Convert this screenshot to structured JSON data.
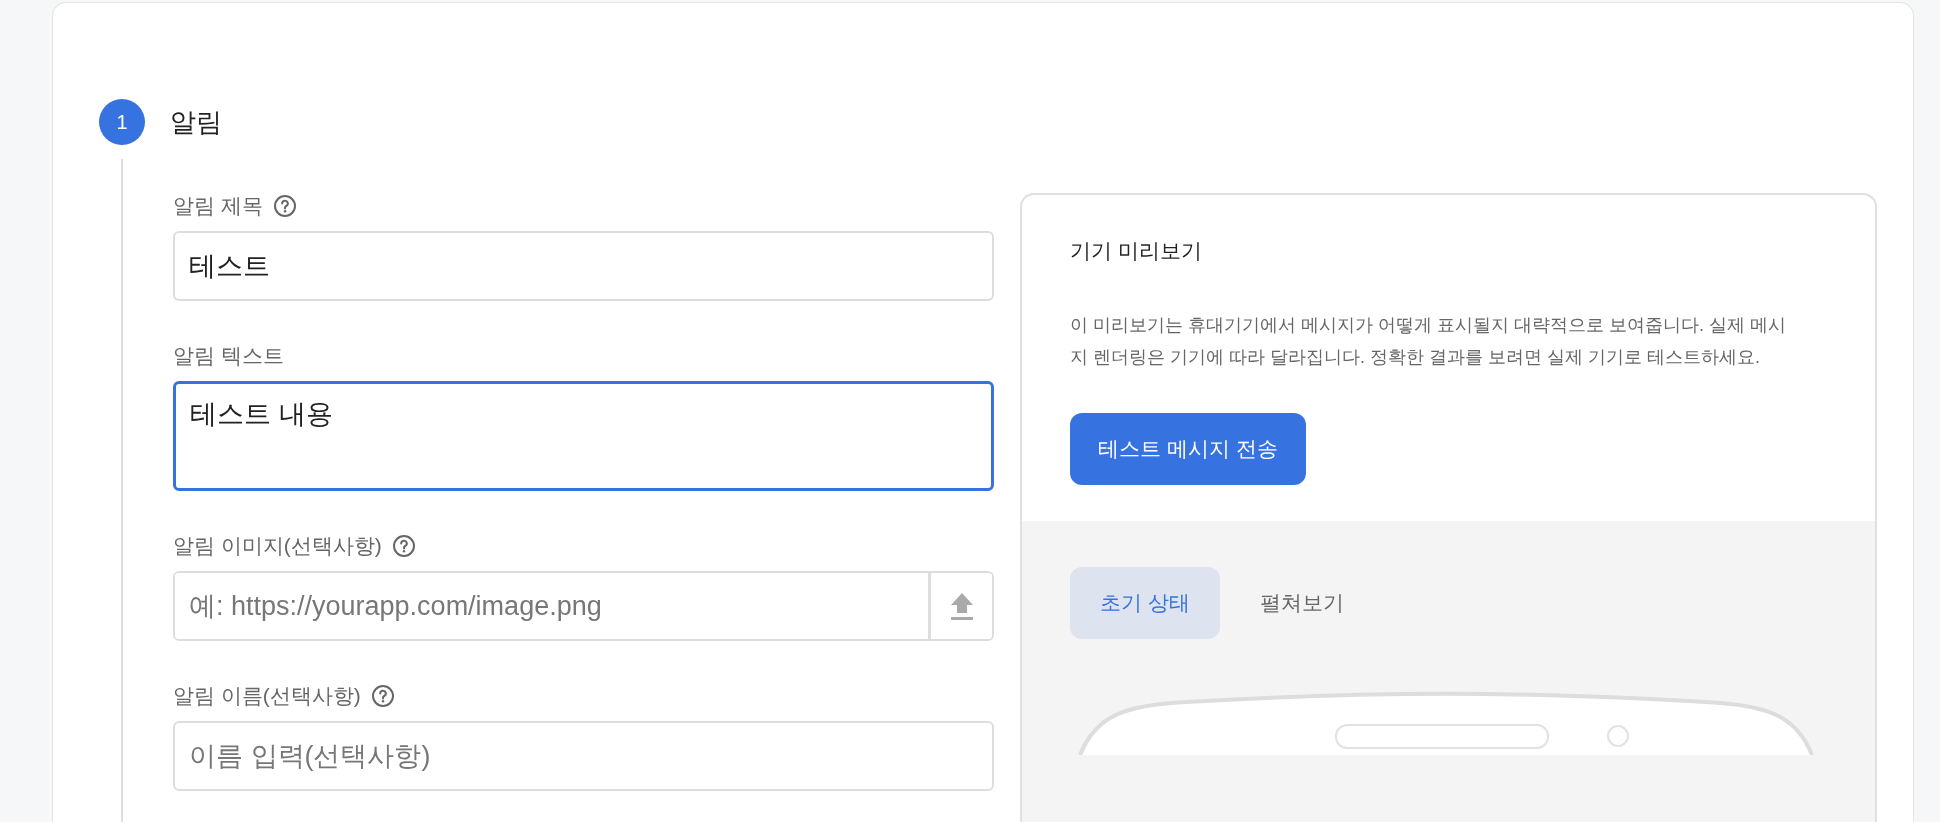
{
  "step": {
    "number": "1",
    "title": "알림"
  },
  "fields": [
    {
      "kind": "input",
      "label": "알림 제목",
      "help": true,
      "value": "테스트",
      "focused": false
    },
    {
      "kind": "textarea",
      "label": "알림 텍스트",
      "help": false,
      "value": "테스트 내용",
      "focused": true
    },
    {
      "kind": "upload",
      "label": "알림 이미지(선택사항)",
      "help": true,
      "placeholder": "예: https://yourapp.com/image.png",
      "focused": false
    },
    {
      "kind": "input",
      "label": "알림 이름(선택사항)",
      "help": true,
      "placeholder": "이름 입력(선택사항)",
      "focused": false
    }
  ],
  "preview": {
    "title": "기기 미리보기",
    "description": "이 미리보기는 휴대기기에서 메시지가 어떻게 표시될지 대략적으로 보여줍니다. 실제 메시지 렌더링은 기기에 따라 달라집니다. 정확한 결과를 보려면 실제 기기로 테스트하세요.",
    "button": "테스트 메시지 전송",
    "tabs": [
      {
        "label": "초기 상태",
        "selected": true
      },
      {
        "label": "펼쳐보기",
        "selected": false
      }
    ]
  }
}
